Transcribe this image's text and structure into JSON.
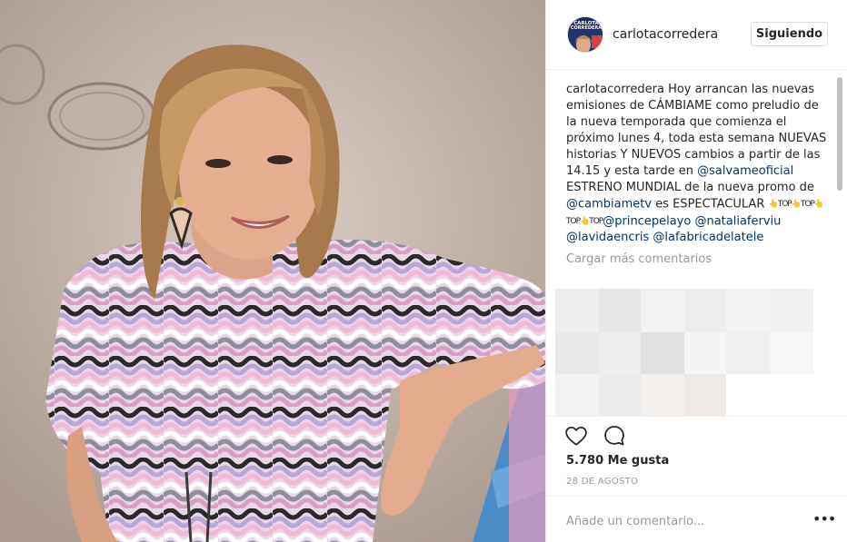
{
  "post": {
    "username": "carlotacorredera",
    "follow_label": "Siguiendo",
    "avatar_text": "CARLOTA CORREDERA",
    "caption": {
      "user": "carlotacorredera",
      "text1": " Hoy arrancan las nuevas emisiones de CÁMBIAME como preludio de la nueva temporada que comienza el próximo lunes 4, toda esta semana NUEVAS historias Y NUEVOS cambios a partir de las 14.15 y esta tarde en ",
      "mention1": "@salvameoficial",
      "text2": " ESTRENO MUNDIAL de la nueva promo de ",
      "mention2": "@cambiametv",
      "text3": " es ESPECTACULAR ",
      "emojis": "👆TOP👆TOP👆TOP👆TOP",
      "mention3": "@princepelayo",
      "mention4": "@nataliaferviu",
      "mention5": "@lavidaencris",
      "mention6": "@lafabricadelatele"
    },
    "load_more": "Cargar más comentarios",
    "likes": "5.780 Me gusta",
    "date": "28 DE AGOSTO",
    "comment_placeholder": "Añade un comentario...",
    "more_options": "•••"
  },
  "icons": {
    "like": "heart-outline-icon",
    "comment": "speech-bubble-icon"
  },
  "colors": {
    "mention": "#003569",
    "muted": "#999999",
    "border": "#efefef"
  }
}
